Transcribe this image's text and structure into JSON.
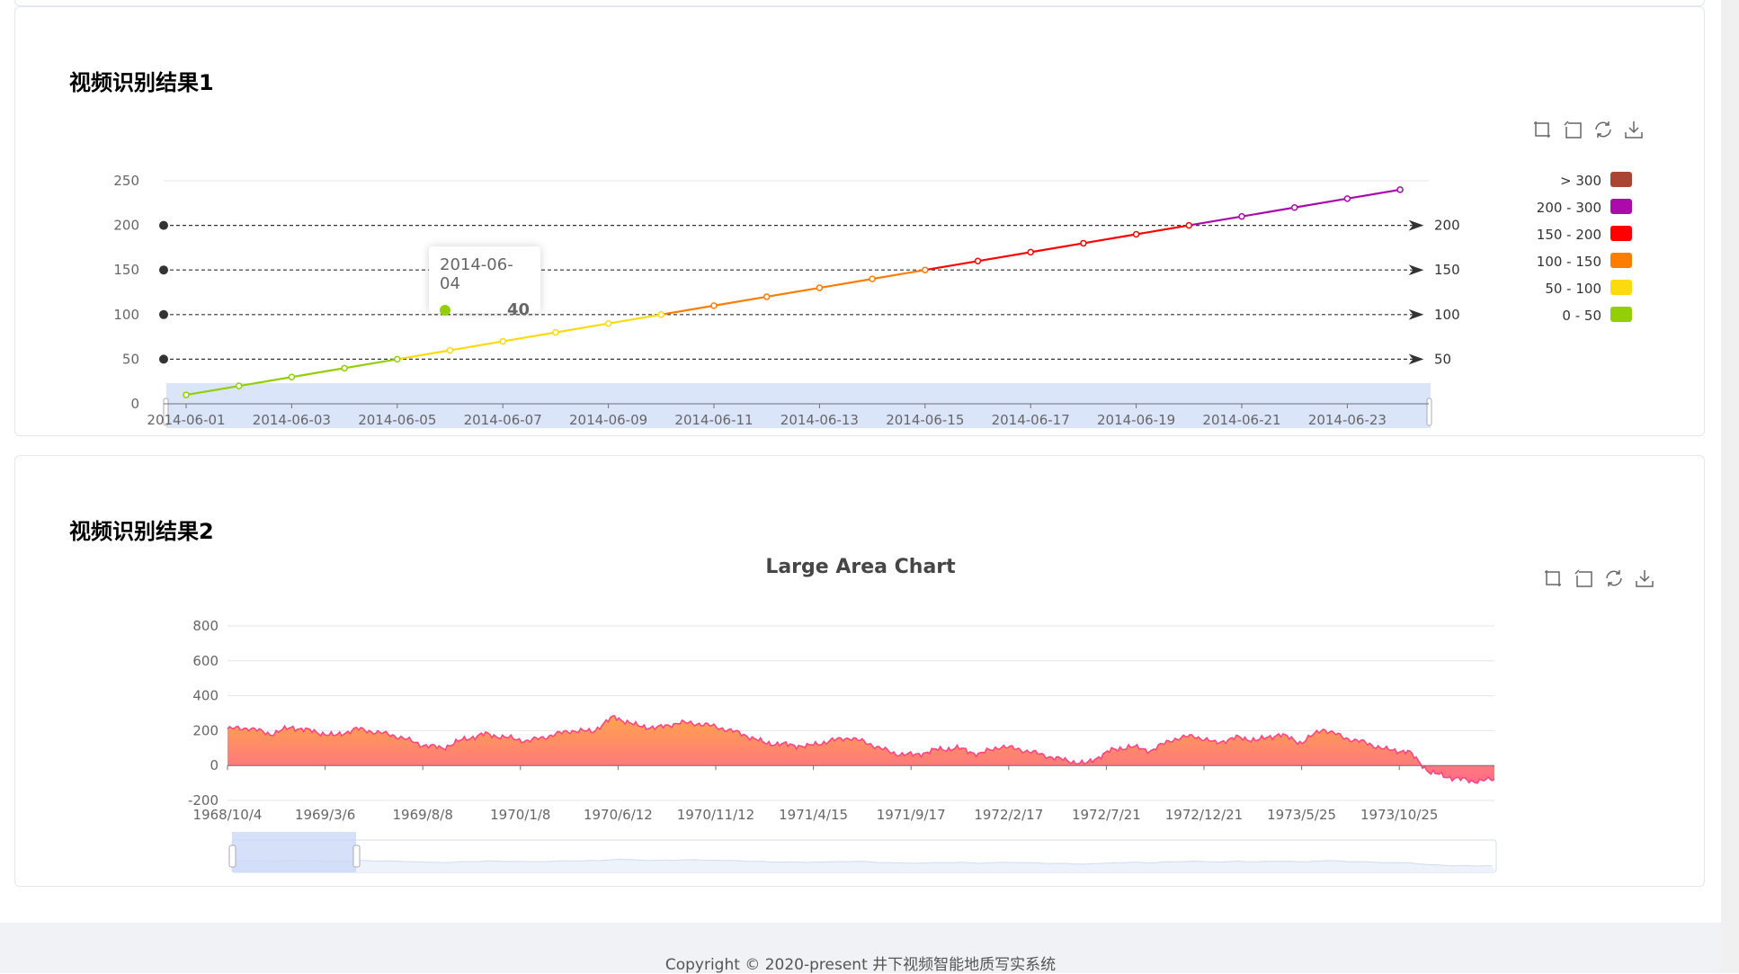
{
  "cards": [
    {
      "title": "视频识别结果1"
    },
    {
      "title": "视频识别结果2"
    }
  ],
  "footer": {
    "text": "Copyright © 2020-present 井下视频智能地质写实系统"
  },
  "toolbox": {
    "icons": [
      "zoom-icon",
      "zoom-reset-icon",
      "restore-icon",
      "download-icon"
    ]
  },
  "chart_data": [
    {
      "type": "line",
      "title": "",
      "x": [
        "2014-06-01",
        "2014-06-02",
        "2014-06-03",
        "2014-06-04",
        "2014-06-05",
        "2014-06-06",
        "2014-06-07",
        "2014-06-08",
        "2014-06-09",
        "2014-06-10",
        "2014-06-11",
        "2014-06-12",
        "2014-06-13",
        "2014-06-14",
        "2014-06-15",
        "2014-06-16",
        "2014-06-17",
        "2014-06-18",
        "2014-06-19",
        "2014-06-20",
        "2014-06-21",
        "2014-06-22",
        "2014-06-23",
        "2014-06-24"
      ],
      "x_tick_labels": [
        "2014-06-01",
        "2014-06-03",
        "2014-06-05",
        "2014-06-07",
        "2014-06-09",
        "2014-06-11",
        "2014-06-13",
        "2014-06-15",
        "2014-06-17",
        "2014-06-19",
        "2014-06-21",
        "2014-06-23"
      ],
      "values": [
        10,
        20,
        30,
        40,
        50,
        60,
        70,
        80,
        90,
        100,
        110,
        120,
        130,
        140,
        150,
        160,
        170,
        180,
        190,
        200,
        210,
        220,
        230,
        240
      ],
      "ylim": [
        0,
        250
      ],
      "y_ticks": [
        0,
        50,
        100,
        150,
        200,
        250
      ],
      "mark_lines": [
        50,
        100,
        150,
        200
      ],
      "visual_map": [
        {
          "label": "> 300",
          "color": "#aa4433"
        },
        {
          "label": "200 - 300",
          "color": "#aa0baa"
        },
        {
          "label": "150 - 200",
          "color": "#ff0000"
        },
        {
          "label": "100 - 150",
          "color": "#fc7d02"
        },
        {
          "label": "50 - 100",
          "color": "#fbdb0f"
        },
        {
          "label": "0 - 50",
          "color": "#93ce07"
        }
      ],
      "tooltip": {
        "date": "2014-06-04",
        "value": "40"
      },
      "grid": true,
      "legend_placement": "right"
    },
    {
      "type": "area",
      "title": "Large Area Chart",
      "x_tick_labels": [
        "1968/10/4",
        "1969/3/6",
        "1969/8/8",
        "1970/1/8",
        "1970/6/12",
        "1970/11/12",
        "1971/4/15",
        "1971/9/17",
        "1972/2/17",
        "1972/7/21",
        "1972/12/21",
        "1973/5/25",
        "1973/10/25"
      ],
      "ylim": [
        -200,
        800
      ],
      "y_ticks": [
        -200,
        0,
        200,
        400,
        600,
        800
      ],
      "anchors": [
        210,
        215,
        180,
        220,
        195,
        170,
        210,
        190,
        165,
        120,
        100,
        150,
        180,
        160,
        140,
        170,
        200,
        195,
        280,
        230,
        215,
        245,
        240,
        215,
        180,
        130,
        120,
        110,
        140,
        160,
        120,
        70,
        60,
        90,
        100,
        65,
        110,
        90,
        60,
        30,
        10,
        80,
        110,
        85,
        150,
        170,
        130,
        160,
        145,
        180,
        130,
        210,
        160,
        130,
        90,
        80,
        -40,
        -70,
        -90,
        -80
      ],
      "grid": true,
      "color_top": "#ffa44c",
      "color_bottom": "#ff6b8b",
      "line_color": "#ff4583"
    }
  ]
}
